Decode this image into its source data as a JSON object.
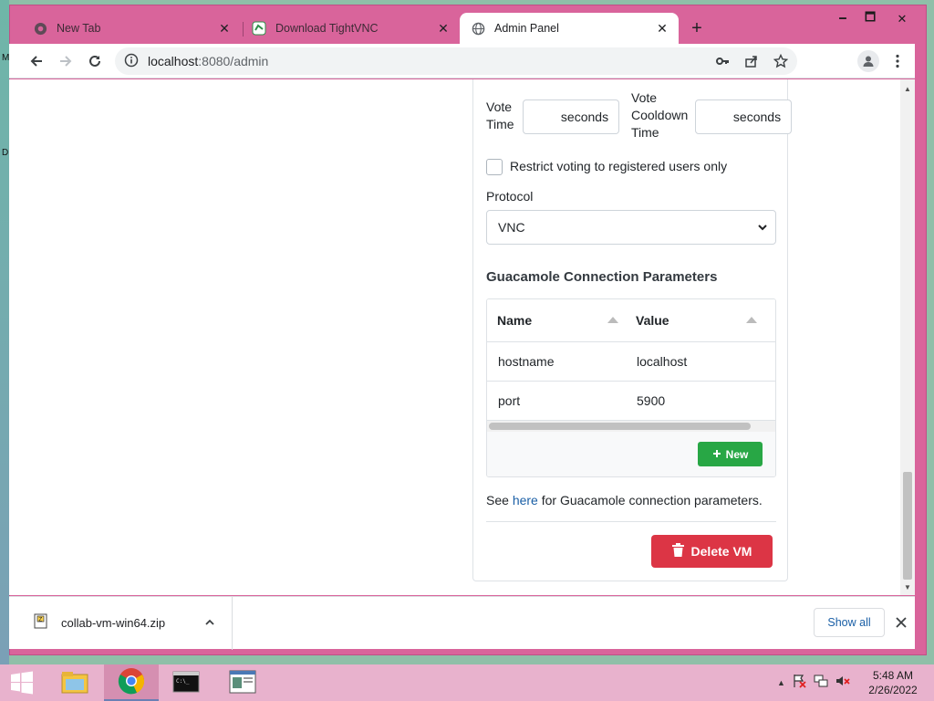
{
  "desktop": {
    "edge_glyphs": [
      "M",
      "D"
    ]
  },
  "window": {
    "minimize": "🗕",
    "maximize": "🗖",
    "close": "✕"
  },
  "tabs": [
    {
      "title": "New Tab",
      "icon": "chrome-icon"
    },
    {
      "title": "Download TightVNC",
      "icon": "tightvnc-icon"
    },
    {
      "title": "Admin Panel",
      "icon": "globe-icon"
    }
  ],
  "toolbar": {
    "url_host": "localhost",
    "url_path": ":8080/admin"
  },
  "form": {
    "vote_time_label": "Vote Time",
    "vote_time_value": "",
    "vote_time_unit": "seconds",
    "cooldown_label": "Vote Cooldown Time",
    "cooldown_value": "",
    "cooldown_unit": "seconds",
    "restrict_label": "Restrict voting to registered users only",
    "restrict_checked": false,
    "protocol_label": "Protocol",
    "protocol_selected": "VNC"
  },
  "guac": {
    "title": "Guacamole Connection Parameters",
    "columns": [
      "Name",
      "Value"
    ],
    "rows": [
      {
        "name": "hostname",
        "value": "localhost"
      },
      {
        "name": "port",
        "value": "5900"
      }
    ],
    "new_button": "New",
    "see_prefix": "See",
    "see_link": "here",
    "see_suffix": "for Guacamole connection parameters."
  },
  "actions": {
    "delete_button": "Delete VM"
  },
  "download": {
    "file_name": "collab-vm-win64.zip",
    "show_all": "Show all"
  },
  "taskbar": {
    "time": "5:48 AM",
    "date": "2/26/2022"
  },
  "colors": {
    "window_frame": "#d9649b",
    "taskbar": "#e8b2cd",
    "new_button": "#28a745",
    "delete_button": "#dc3545",
    "link": "#1a5fa6"
  }
}
